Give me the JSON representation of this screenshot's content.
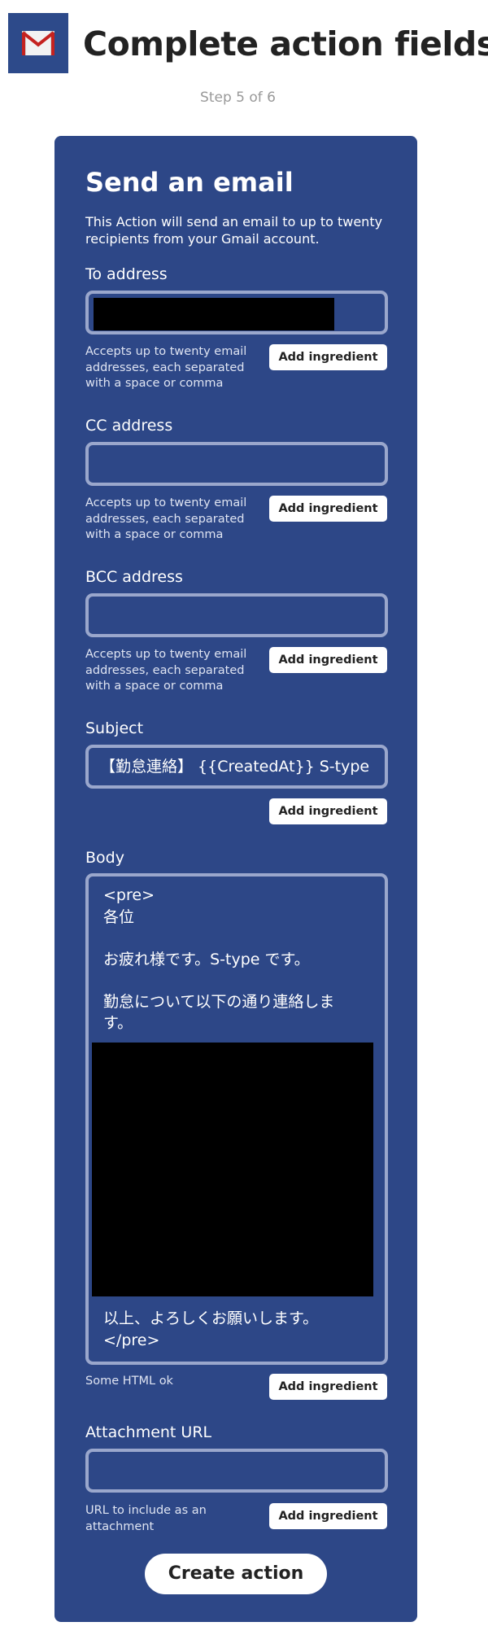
{
  "header": {
    "icon": "gmail-icon",
    "title": "Complete action fields",
    "step": "Step 5 of 6"
  },
  "panel": {
    "title": "Send an email",
    "description": "This Action will send an email to up to twenty recipients from your Gmail account.",
    "ingredient_label": "Add ingredient",
    "fields": {
      "to": {
        "label": "To address",
        "value": "",
        "hint": "Accepts up to twenty email addresses, each separated with a space or comma"
      },
      "cc": {
        "label": "CC address",
        "value": "",
        "hint": "Accepts up to twenty email addresses, each separated with a space or comma"
      },
      "bcc": {
        "label": "BCC address",
        "value": "",
        "hint": "Accepts up to twenty email addresses, each separated with a space or comma"
      },
      "subject": {
        "label": "Subject",
        "value": "【勤怠連絡】 {{CreatedAt}} S-type"
      },
      "body": {
        "label": "Body",
        "lines": [
          "<pre>",
          "各位",
          "お疲れ様です。S-type です。",
          "勤怠について以下の通り連絡しま",
          "す。",
          "以上、よろしくお願いします。",
          "</pre>"
        ],
        "hint": "Some HTML ok"
      },
      "attachment": {
        "label": "Attachment URL",
        "value": "",
        "hint": "URL to include as an attachment"
      }
    },
    "create_label": "Create action"
  },
  "colors": {
    "panel_bg": "#2d4787",
    "input_border": "#9aa7cc",
    "button_bg": "#ffffff"
  }
}
